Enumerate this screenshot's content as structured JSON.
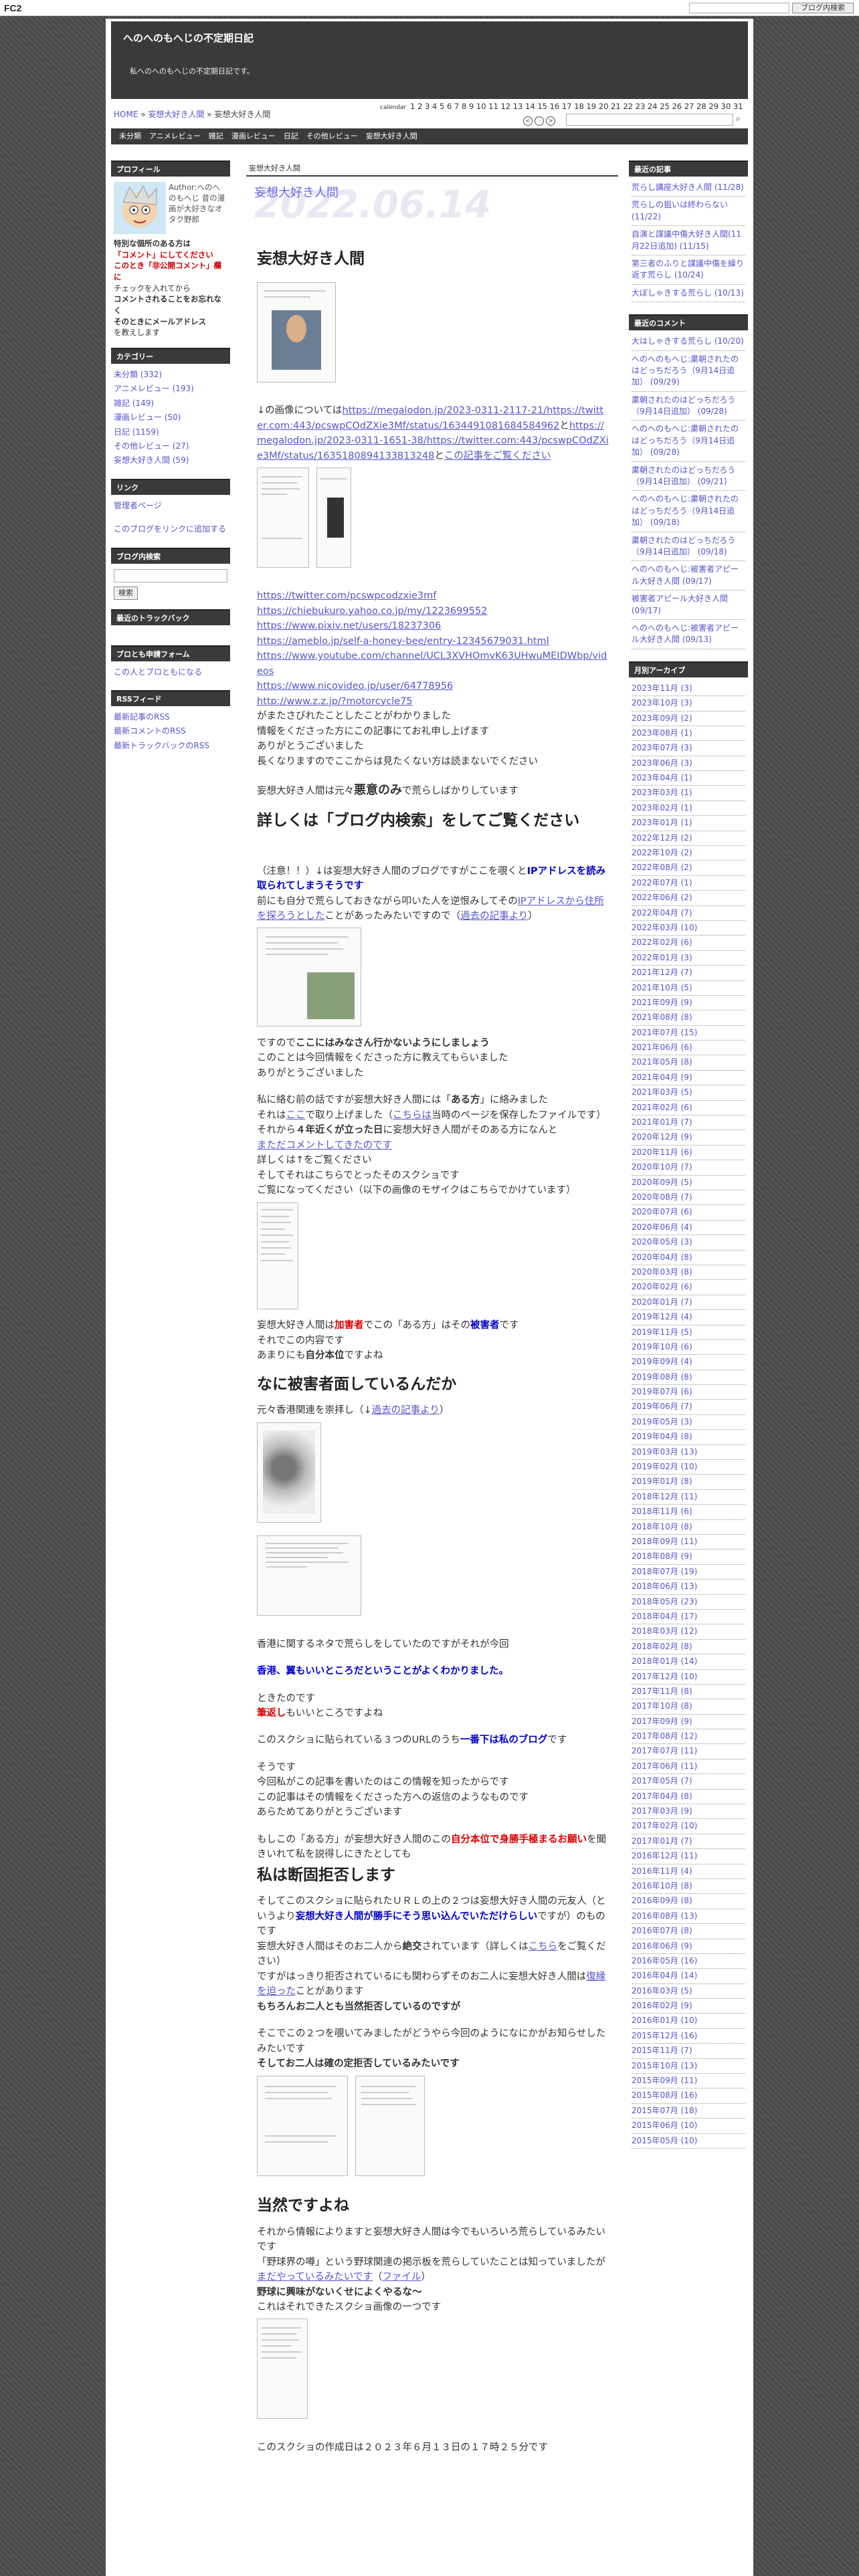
{
  "topbar": {
    "logo": "FC2",
    "search_btn": "ブログ内検索"
  },
  "blog": {
    "title": "へのへのもへじの不定期日記",
    "description": "私へのへのもへじの不定期日記です。"
  },
  "breadcrumb": {
    "home": "HOME",
    "sep1": "»",
    "category": "妄想大好き人間",
    "sep2": "»",
    "current": "妄想大好き人間"
  },
  "calendar": {
    "label": "calendar",
    "days": "1 2 3 4 5 6 7 8 9 10 11 12 13 14 15 16 17 18 19 20 21 22 23 24 25 26 27 28 29 30 31"
  },
  "nav": [
    "未分類",
    "アニメレビュー",
    "雑記",
    "漫画レビュー",
    "日記",
    "その他レビュー",
    "妄想大好き人間"
  ],
  "left": {
    "profile_head": "プロフィール",
    "profile_text": "Author:へのへのもへじ 昔の漫画が大好きなオタク野郎",
    "profile_notice": [
      "特別な個所のある方は",
      "「コメント」にしてください",
      "このとき「非公開コメント」欄に",
      "チェックを入れてから",
      "コメントされることをお忘れなく",
      "そのときにメールアドレス",
      "を教えします"
    ],
    "category_head": "カテゴリー",
    "categories": [
      "未分類 (332)",
      "アニメレビュー (193)",
      "雑記 (149)",
      "漫画レビュー (50)",
      "日記 (1159)",
      "その他レビュー (27)",
      "妄想大好き人間 (59)"
    ],
    "link_head": "リンク",
    "links": [
      "管理者ページ",
      "このブログをリンクに追加する"
    ],
    "search_head": "ブログ内検索",
    "search_btn": "検索",
    "tb_head": "最近のトラックバック",
    "friend_head": "ブロとも申請フォーム",
    "friend_link": "この人とブロともになる",
    "rss_head": "RSSフィード",
    "rss": [
      "最新記事のRSS",
      "最新コメントのRSS",
      "最新トラックバックのRSS"
    ]
  },
  "right": {
    "recent_head": "最近の記事",
    "recent": [
      "荒らし講座大好き人間 (11/28)",
      "荒らしの狙いは終わらない (11/22)",
      "自演と謀議中傷大好き人間(11月22日追加) (11/15)",
      "第三者のふりと謀議中傷を繰り返す荒らし (10/24)",
      "大ぼしゃきする荒らし (10/13)"
    ],
    "comments_head": "最近のコメント",
    "comments": [
      "大はしゃきする荒らし (10/20)",
      "へのへのもへじ:粛朝されたのはどっちだろう（9月14日追加） (09/29)",
      "粛朝されたのはどっちだろう（9月14日追加） (09/28)",
      "へのへのもへじ:粛朝されたのはどっちだろう（9月14日追加） (09/28)",
      "粛朝されたのはどっちだろう（9月14日追加） (09/21)",
      "へのへのもへじ:粛朝されたのはどっちだろう（9月14日追加） (09/18)",
      "粛朝されたのはどっちだろう（9月14日追加） (09/18)",
      "へのへのもへじ:被害者アピール大好き人間 (09/17)",
      "被害者アピール大好き人間 (09/17)",
      "へのへのもへじ:被害者アピール大好き人間 (09/13)"
    ],
    "archive_head": "月別アーカイブ",
    "archives": [
      "2023年11月 (3)",
      "2023年10月 (3)",
      "2023年09月 (2)",
      "2023年08月 (1)",
      "2023年07月 (3)",
      "2023年06月 (3)",
      "2023年04月 (1)",
      "2023年03月 (1)",
      "2023年02月 (1)",
      "2023年01月 (1)",
      "2022年12月 (2)",
      "2022年10月 (2)",
      "2022年08月 (2)",
      "2022年07月 (1)",
      "2022年06月 (2)",
      "2022年04月 (7)",
      "2022年03月 (10)",
      "2022年02月 (6)",
      "2022年01月 (3)",
      "2021年12月 (7)",
      "2021年10月 (5)",
      "2021年09月 (9)",
      "2021年08月 (8)",
      "2021年07月 (15)",
      "2021年06月 (6)",
      "2021年05月 (8)",
      "2021年04月 (9)",
      "2021年03月 (5)",
      "2021年02月 (6)",
      "2021年01月 (7)",
      "2020年12月 (9)",
      "2020年11月 (6)",
      "2020年10月 (7)",
      "2020年09月 (5)",
      "2020年08月 (7)",
      "2020年07月 (6)",
      "2020年06月 (4)",
      "2020年05月 (3)",
      "2020年04月 (8)",
      "2020年03月 (8)",
      "2020年02月 (6)",
      "2020年01月 (7)",
      "2019年12月 (4)",
      "2019年11月 (5)",
      "2019年10月 (6)",
      "2019年09月 (4)",
      "2019年08月 (8)",
      "2019年07月 (6)",
      "2019年06月 (7)",
      "2019年05月 (3)",
      "2019年04月 (8)",
      "2019年03月 (13)",
      "2019年02月 (10)",
      "2019年01月 (8)",
      "2018年12月 (11)",
      "2018年11月 (6)",
      "2018年10月 (8)",
      "2018年09月 (11)",
      "2018年08月 (9)",
      "2018年07月 (19)",
      "2018年06月 (13)",
      "2018年05月 (23)",
      "2018年04月 (17)",
      "2018年03月 (12)",
      "2018年02月 (8)",
      "2018年01月 (14)",
      "2017年12月 (10)",
      "2017年11月 (8)",
      "2017年10月 (8)",
      "2017年09月 (9)",
      "2017年08月 (12)",
      "2017年07月 (11)",
      "2017年06月 (11)",
      "2017年05月 (7)",
      "2017年04月 (8)",
      "2017年03月 (9)",
      "2017年02月 (10)",
      "2017年01月 (7)",
      "2016年12月 (11)",
      "2016年11月 (4)",
      "2016年10月 (8)",
      "2016年09月 (8)",
      "2016年08月 (13)",
      "2016年07月 (8)",
      "2016年06月 (9)",
      "2016年05月 (16)",
      "2016年04月 (14)",
      "2016年03月 (5)",
      "2016年02月 (9)",
      "2016年01月 (10)",
      "2015年12月 (16)",
      "2015年11月 (7)",
      "2015年10月 (13)",
      "2015年09月 (11)",
      "2015年08月 (16)",
      "2015年07月 (18)",
      "2015年06月 (10)",
      "2015年05月 (10)"
    ]
  },
  "entry": {
    "cat_head": "妄想大好き人間",
    "title": "妄想大好き人間",
    "date": "2022.06.14",
    "h1": "妄想大好き人間",
    "p_img_pre": "↓の画像については",
    "url1": "https://megalodon.jp/2023-0311-2117-21/https://twitter.com:443/pcswpCOdZXie3Mf/status/1634491081684584962",
    "p_img_mid": "と",
    "url2": "https://megalodon.jp/2023-0311-1651-38/https://twitter.com:443/pcswpCOdZXie3Mf/status/1635180894133813248",
    "p_img_post": "と",
    "p_img_link": "この記事をご覧ください",
    "urls": [
      "https://twitter.com/pcswpcodzxie3mf",
      "https://chiebukuro.yahoo.co.jp/my/1223699552",
      "https://www.pixiv.net/users/18237306",
      "https://ameblo.jp/self-a-honey-bee/entry-12345679031.html",
      "https://www.youtube.com/channel/UCL3XVHOmvK63UHwuMEIDWbp/videos",
      "https://www.nicovideo.jp/user/64778956",
      "http://www.z.z.jp/?motorcycle75"
    ],
    "p1": [
      "がまたさびれたことしたことがわかりました",
      "情報をくださった方にこの記事にてお礼申し上げます",
      "ありがとうございました",
      "長くなりますのでここからは見たくない方は読まないでください"
    ],
    "p2_pre": "妄想大好き人間は元々",
    "p2_bold": "悪意のみ",
    "p2_post": "で荒らしばかりしています",
    "h2a": "詳しくは「ブログ内検索」をしてご覧ください",
    "warn_pre": "（注意！！）↓は妄想大好き人間のブログですがここを覗くと",
    "warn_blue": "IPアドレスを読み取られてしまうそうです",
    "warn2_pre": "前にも自分で荒らしておきながら叩いた人を逆恨みしてその",
    "warn2_link1": "IPアドレスから住所を探ろうとした",
    "warn2_mid": "ことがあったみたいですので（",
    "warn2_link2": "過去の記事より",
    "warn2_post": "）",
    "p3_pre": "ですので",
    "p3_bold": "ここにはみなさん行かないようにしましょう",
    "p3": [
      "このことは今回情報をくださった方に教えてもらいました",
      "ありがとうございました"
    ],
    "p4_a": "私に絡む前の話ですが妄想大好き人間には「",
    "p4_b": "ある方",
    "p4_c": "」に絡みました",
    "p4_d": "それは",
    "p4_link1": "ここ",
    "p4_e": "で取り上げました（",
    "p4_link2": "こちらは",
    "p4_f": "当時のページを保存したファイルです）",
    "p4_g": "それから",
    "p4_bold": "４年近くが立った日",
    "p4_h": "に妄想大好き人間がそのある方になんと",
    "p4_link3": "まただコメントしてきたのです",
    "p4_i": [
      "詳しくは↑をご覧ください",
      "そしてそれはこちらでとったそのスクショです",
      "ご覧になってください（以下の画像のモザイクはこちらでかけています）"
    ],
    "p5_a": "妄想大好き人間は",
    "p5_red": "加害者",
    "p5_b": "でこの「ある方」はその",
    "p5_blue": "被害者",
    "p5_c": "です",
    "p5_d": "それでこの内容です",
    "p5_e": "あまりにも",
    "p5_bold": "自分本位",
    "p5_f": "ですよね",
    "h2b": "なに被害者面しているんだか",
    "p6_a": "元々香港関連を崇拝し（↓",
    "p6_link": "過去の記事より",
    "p6_b": "）",
    "p7": "香港に関するネタで荒らしをしていたのですがそれが今回",
    "p7_blue": "香港、翼もいいところだということがよくわかりました。",
    "p8": "ときたのです",
    "p8_red": "筆返し",
    "p8_b": "もいいところですよね",
    "p9_a": "このスクショに貼られている３つのURLのうち",
    "p9_blue": "一番下は私のブログ",
    "p9_b": "です",
    "p10": [
      "そうです",
      "今回私がこの記事を書いたのはこの情報を知ったからです",
      "この記事はその情報をくださった方への返信のようなものです",
      "あらためてありがとうございます"
    ],
    "p11_a": "もしこの「ある方」が妄想大好き人間のこの",
    "p11_red": "自分本位で身勝手極まるお願い",
    "p11_b": "を聞きいれて私を説得しにきたとしても",
    "h2c": "私は断固拒否します",
    "p12_a": "そしてこのスクショに貼られたＵＲＬの上の２つは妄想大好き人間の元友人（というより",
    "p12_blue": "妄想大好き人間が勝手にそう思い込んでいただけらしい",
    "p12_b": "ですが）のものです",
    "p12_c": "妄想大好き人間はそのお二人から",
    "p12_bold": "絶交",
    "p12_d": "されています（詳しくは",
    "p12_link1": "こちら",
    "p12_e": "をご覧ください）",
    "p12_f": "ですがはっきり拒否されているにも関わらずそのお二人に妄想大好き人間は",
    "p12_link2": "復縁を迫った",
    "p12_g": "ことがあります",
    "p12_bold2": "もちろんお二人とも当然拒否しているのですが",
    "p13": "そこでこの２つを覗いてみましたがどうやら今回のようになにかがお知らせしたみたいです",
    "p13_bold": "そしてお二人は",
    "p13_bold2": "確の定拒否しているみたいです",
    "h2d": "当然ですよね",
    "p14": [
      "それから情報によりますと妄想大好き人間は今でもいろいろ荒らしているみたいです",
      "「野球界の噂」という野球関連の掲示板を荒らしていたことは知っていましたが"
    ],
    "p14_link1": "まだやっているみたいです",
    "p14_a": "（",
    "p14_link2": "ファイル",
    "p14_b": "）",
    "p15_bold": "野球に興味がないくせによくやるな～",
    "p15": "これはそれできたスクショ画像の一つです",
    "p16": "このスクショの作成日は２０２３年６月１３日の１７時２５分です"
  }
}
